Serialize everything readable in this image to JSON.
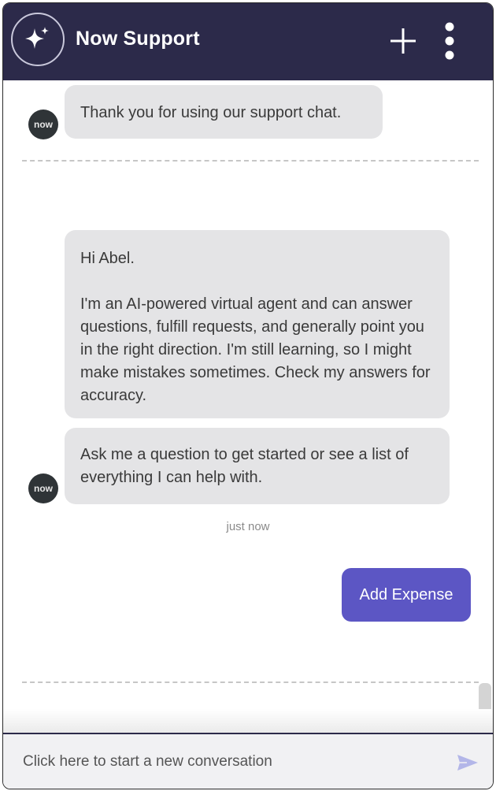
{
  "header": {
    "title": "Now Support",
    "logo_icon": "sparkle-icon",
    "new_chat_icon": "plus-icon",
    "more_icon": "more-vertical-icon",
    "background_color": "#2c2a4a"
  },
  "avatar": {
    "label": "now",
    "background_color": "#2f3437"
  },
  "messages": [
    {
      "sender": "agent",
      "text": "Thank you for using our support chat."
    },
    {
      "sender": "agent",
      "greeting": "Hi Abel.",
      "text": "I'm an AI-powered virtual agent and can answer questions, fulfill requests, and generally point you in the right direction. I'm still learning, so I might make mistakes sometimes. Check my answers for accuracy."
    },
    {
      "sender": "agent",
      "text": "Ask me a question to get started or see a list of everything I can help with."
    }
  ],
  "timestamp": "just now",
  "action_button": {
    "label": "Add Expense",
    "color": "#5c56c4"
  },
  "composer": {
    "placeholder": "Click here to start a new conversation",
    "send_icon": "send-icon"
  }
}
